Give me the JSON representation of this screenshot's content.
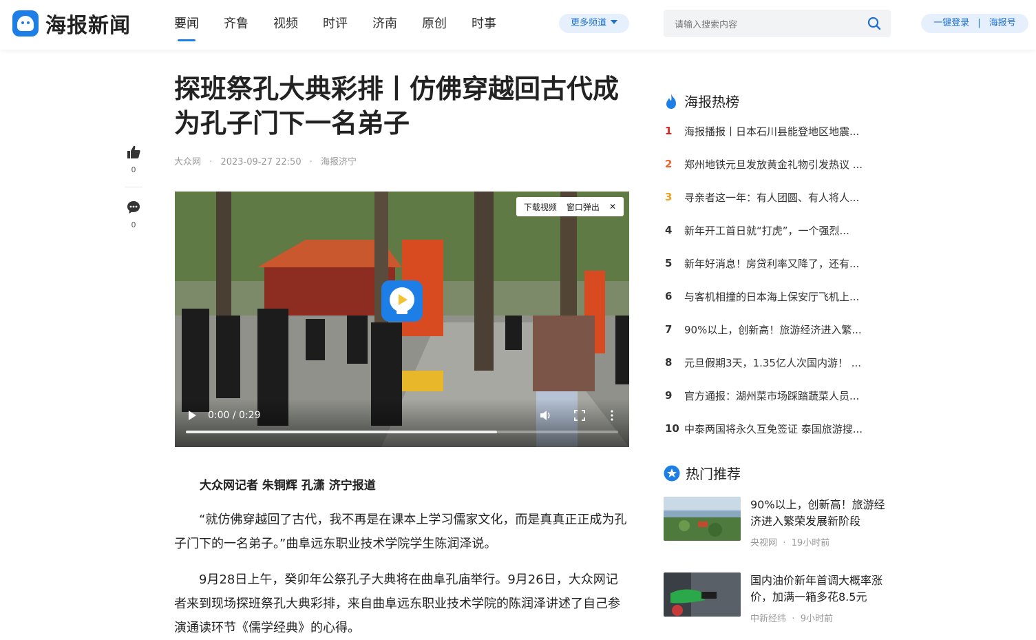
{
  "header": {
    "logo_text": "海报新闻",
    "nav": [
      "要闻",
      "齐鲁",
      "视频",
      "时评",
      "济南",
      "原创",
      "时事"
    ],
    "more_channels": "更多频道",
    "search_placeholder": "请输入搜索内容",
    "login": "一键登录",
    "account": "海报号"
  },
  "side_actions": {
    "like_count": "0",
    "comment_count": "0"
  },
  "article": {
    "title": "探班祭孔大典彩排丨仿佛穿越回古代成为孔子门下一名弟子",
    "source": "大众网",
    "datetime": "2023-09-27 22:50",
    "channel": "海报济宁",
    "video": {
      "download_label": "下载视频",
      "popup_label": "窗口弹出",
      "close_symbol": "✕",
      "time": "0:00 / 0:29",
      "progress_fraction": 0.72
    },
    "byline": "大众网记者 朱铜辉 孔潇 济宁报道",
    "paragraphs": [
      "“就仿佛穿越回了古代，我不再是在课本上学习儒家文化，而是真真正正成为孔子门下的一名弟子。”曲阜远东职业技术学院学生陈润泽说。",
      "9月28日上午，癸卯年公祭孔子大典将在曲阜孔庙举行。9月26日，大众网记者来到现场探班祭孔大典彩排，来自曲阜远东职业技术学院的陈润泽讲述了自己参演通读环节《儒学经典》的心得。"
    ]
  },
  "hot_rank": {
    "title": "海报热榜",
    "items": [
      {
        "rank": "1",
        "text": "海报播报丨日本石川县能登地区地震..."
      },
      {
        "rank": "2",
        "text": "郑州地铁元旦发放黄金礼物引发热议 ..."
      },
      {
        "rank": "3",
        "text": "寻亲者这一年：有人团圆、有人将人..."
      },
      {
        "rank": "4",
        "text": "新年开工首日就“打虎”，一个强烈..."
      },
      {
        "rank": "5",
        "text": "新年好消息！房贷利率又降了，还有..."
      },
      {
        "rank": "6",
        "text": "与客机相撞的日本海上保安厅飞机上..."
      },
      {
        "rank": "7",
        "text": "90%以上，创新高！旅游经济进入繁..."
      },
      {
        "rank": "8",
        "text": "元旦假期3天，1.35亿人次国内游！ ..."
      },
      {
        "rank": "9",
        "text": "官方通报：湖州菜市场踩踏蔬菜人员..."
      },
      {
        "rank": "10",
        "text": "中泰两国将永久互免签证 泰国旅游搜..."
      }
    ]
  },
  "recommend": {
    "title": "热门推荐",
    "items": [
      {
        "title": "90%以上，创新高！旅游经济进入繁荣发展新阶段",
        "source": "央视网",
        "time": "19小时前"
      },
      {
        "title": "国内油价新年首调大概率涨价，加满一箱多花8.5元",
        "source": "中新经纬",
        "time": "9小时前"
      }
    ]
  },
  "colors": {
    "accent": "#1d7fe5",
    "rank1": "#e02020",
    "rank2": "#f0622d",
    "rank3": "#f0a020"
  }
}
